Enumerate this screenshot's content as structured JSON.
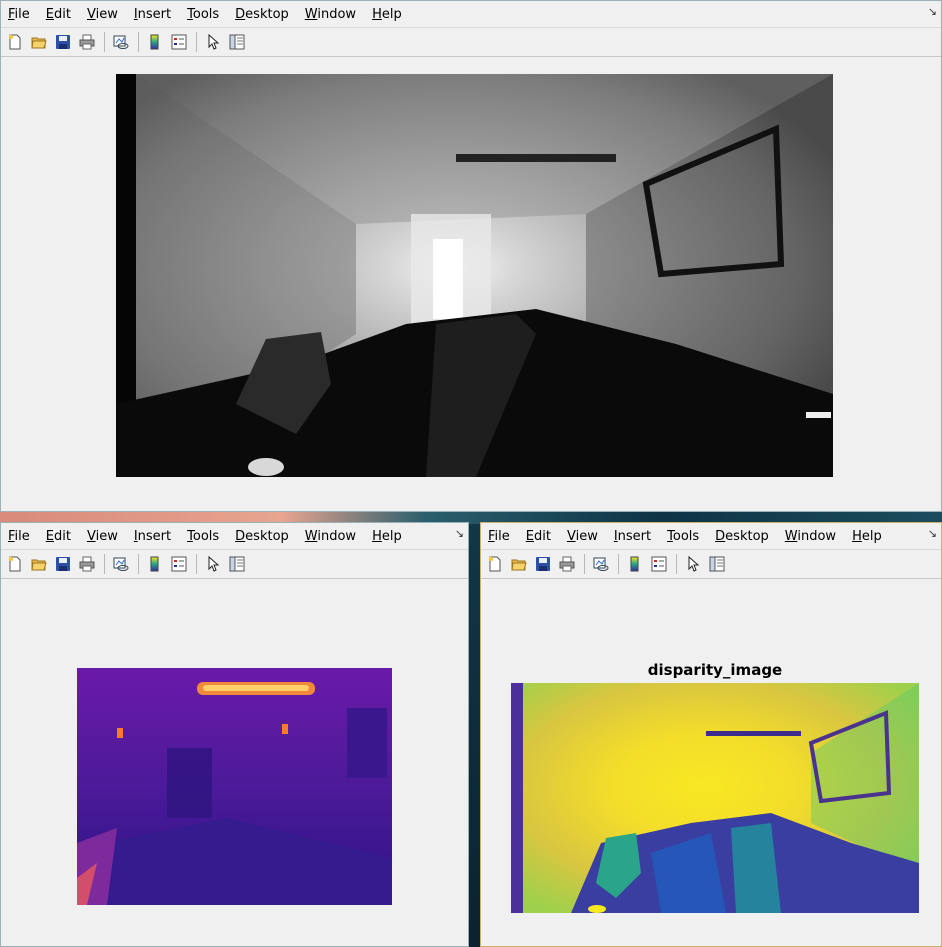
{
  "menu": [
    "File",
    "Edit",
    "View",
    "Insert",
    "Tools",
    "Desktop",
    "Window",
    "Help"
  ],
  "menu_mnemonics": [
    "F",
    "E",
    "V",
    "I",
    "T",
    "D",
    "W",
    "H"
  ],
  "toolbar_icons": [
    "new-figure-icon",
    "open-file-icon",
    "save-icon",
    "print-icon",
    "link-plot-icon",
    "colorbar-icon",
    "legend-icon",
    "pointer-icon",
    "property-inspector-icon"
  ],
  "windows": {
    "top": {
      "image": "depth-grayscale"
    },
    "bottom_left": {
      "image": "thermal-image"
    },
    "bottom_right": {
      "title": "disparity_image",
      "image": "disparity-colormap"
    }
  },
  "colors": {
    "figure_bg": "#f0f0f0",
    "active_border": "#c9b26a"
  }
}
